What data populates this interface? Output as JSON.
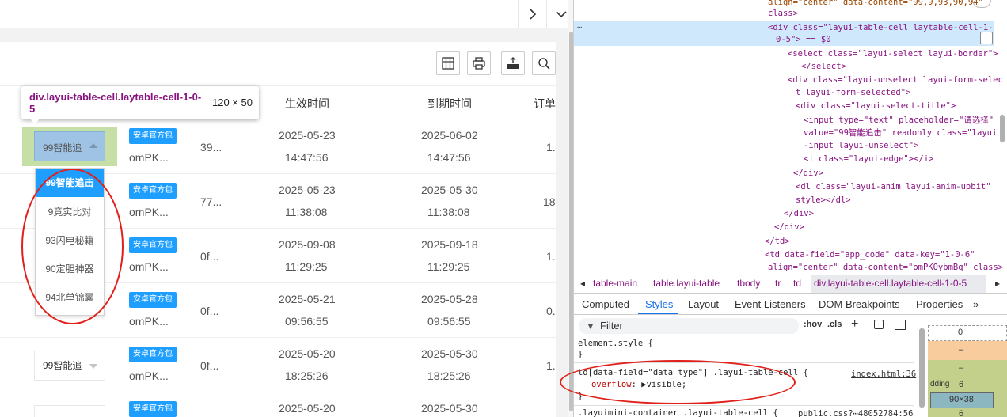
{
  "app": {
    "toolbar_icons": [
      "columns-icon",
      "print-icon",
      "export-icon",
      "search-icon"
    ],
    "headers": [
      "生效时间",
      "到期时间",
      "订单"
    ],
    "rows": [
      {
        "select": "99智能追",
        "badge": "安卓官方包",
        "open_id": "omPK...",
        "col_a": "39...",
        "start_date": "2025-05-23",
        "start_time": "14:47:56",
        "end_date": "2025-06-02",
        "end_time": "14:47:56",
        "order": "1."
      },
      {
        "select": "",
        "badge": "安卓官方包",
        "open_id": "omPK...",
        "col_a": "77...",
        "start_date": "2025-05-23",
        "start_time": "11:38:08",
        "end_date": "2025-05-30",
        "end_time": "11:38:08",
        "order": "18"
      },
      {
        "select": "",
        "badge": "安卓官方包",
        "open_id": "omPK...",
        "col_a": "0f...",
        "start_date": "2025-09-08",
        "start_time": "11:29:25",
        "end_date": "2025-09-18",
        "end_time": "11:29:25",
        "order": "1."
      },
      {
        "select": "",
        "badge": "安卓官方包",
        "open_id": "omPK...",
        "col_a": "0f...",
        "start_date": "2025-05-21",
        "start_time": "09:56:55",
        "end_date": "2025-05-28",
        "end_time": "09:56:55",
        "order": "0."
      },
      {
        "select": "99智能追",
        "badge": "安卓官方包",
        "open_id": "omPK...",
        "col_a": "0f...",
        "start_date": "2025-05-20",
        "start_time": "18:25:26",
        "end_date": "2025-05-30",
        "end_time": "18:25:26",
        "order": "1."
      },
      {
        "select": "",
        "badge": "安卓官方包",
        "open_id": "",
        "col_a": "",
        "start_date": "2025-05-20",
        "start_time": "",
        "end_date": "2025-05-30",
        "end_time": "",
        "order": ""
      }
    ],
    "dropdown": [
      "99智能追击",
      "9竞实比对",
      "93闪电秘籍",
      "90定胆神器",
      "94北单锦囊"
    ],
    "tooltip": {
      "name": "div.layui-table-cell.laytable-cell-1-0-5",
      "size": "120 × 50"
    }
  },
  "devtools": {
    "code_lines": [
      "align=\"center\" data-content=\"99,9,93,90,94\"",
      "class>",
      "<div class=\"layui-table-cell laytable-cell-1-",
      "0-5\"> == $0",
      "<select class=\"layui-select layui-border\">",
      "</select>",
      "<div class=\"layui-unselect layui-form-selec",
      "t layui-form-selected\">",
      "<div class=\"layui-select-title\">",
      "<input type=\"text\" placeholder=\"请选择\"",
      "value=\"99智能追击\" readonly class=\"layui",
      "-input layui-unselect\">",
      "<i class=\"layui-edge\"></i>",
      "</div>",
      "<dl class=\"layui-anim layui-anim-upbit\"",
      "style></dl>",
      "</div>",
      "</div>",
      "</td>",
      "<td data-field=\"app_code\" data-key=\"1-0-6\"",
      "align=\"center\" data-content=\"omPKOybmBq\" class>"
    ],
    "breadcrumbs": [
      "table-main",
      "table.layui-table",
      "tbody",
      "tr",
      "td",
      "div.layui-table-cell.laytable-cell-1-0-5"
    ],
    "tabs": [
      "Computed",
      "Styles",
      "Layout",
      "Event Listeners",
      "DOM Breakpoints",
      "Properties"
    ],
    "active_tab": "Styles",
    "filter_placeholder": "Filter",
    "filter_tools": [
      ":hov",
      ".cls"
    ],
    "styles": {
      "element_style": "element.style {",
      "close": "}",
      "rule_selector": "td[data-field=\"data_type\"] .layui-table-cell {",
      "rule_prop": "overflow",
      "rule_value": "visible;",
      "rule_source": "index.html:36",
      "next_selector": ".layuimini-container .layui-table-cell {",
      "next_source": "public.css?⋯48052784:56"
    },
    "box": {
      "margin": "0",
      "dash1": "–",
      "dash2": "–",
      "padding_label": "dding",
      "padding": "6",
      "content": "90×38",
      "bottom": "6"
    }
  }
}
